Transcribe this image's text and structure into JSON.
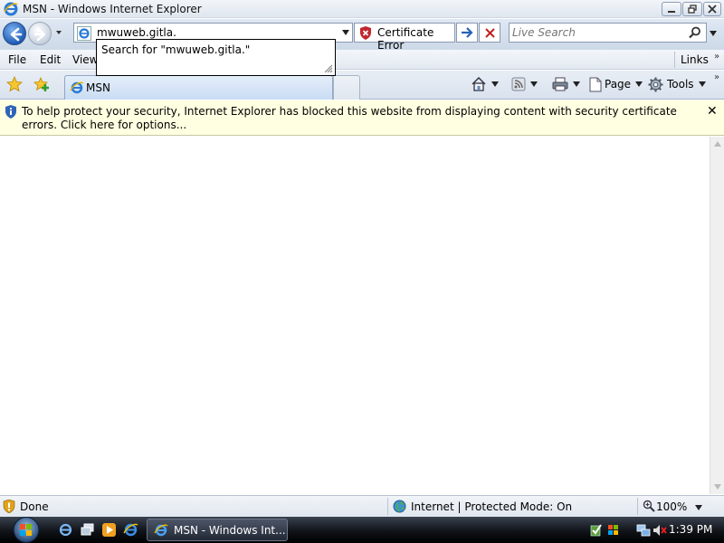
{
  "window": {
    "title": "MSN - Windows Internet Explorer"
  },
  "address": {
    "url": "mwuweb.gitla.",
    "certificate_label": "Certificate Error",
    "search_placeholder": "Live Search"
  },
  "suggestion": {
    "text": "Search for \"mwuweb.gitla.\""
  },
  "menu": {
    "items": [
      "File",
      "Edit",
      "View"
    ],
    "links_label": "Links"
  },
  "tabs": {
    "active_title": "MSN"
  },
  "command_bar": {
    "page_label": "Page",
    "tools_label": "Tools"
  },
  "infobar": {
    "message": "To help protect your security, Internet Explorer has blocked this website from displaying content with security certificate errors. Click here for options..."
  },
  "status": {
    "text": "Done",
    "zone": "Internet | Protected Mode: On",
    "zoom": "100%"
  },
  "taskbar": {
    "task_label": "MSN - Windows Int...",
    "clock": "1:39 PM"
  },
  "colors": {
    "infobar_bg": "#ffffe1",
    "accent_blue": "#1e5bb4",
    "cert_error_red": "#c0272d"
  }
}
